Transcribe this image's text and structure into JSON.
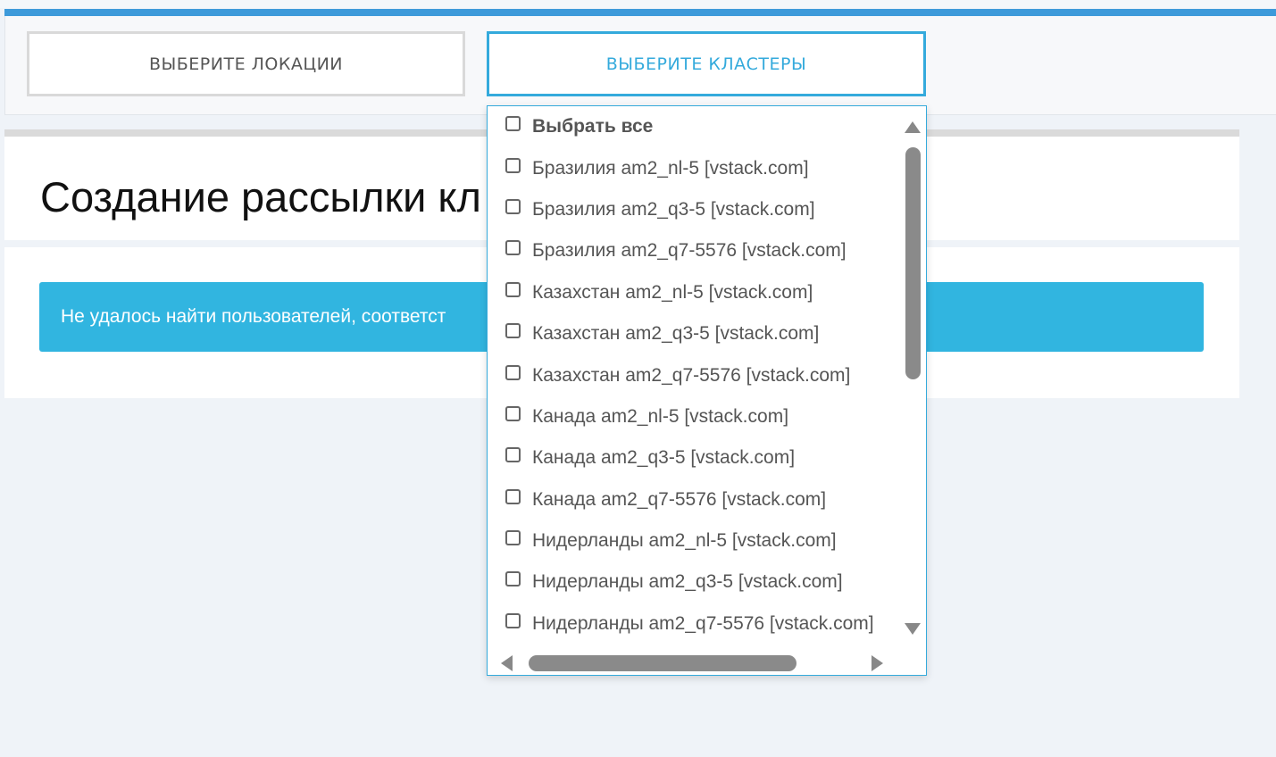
{
  "toolbar": {
    "locations_button": "ВЫБЕРИТЕ ЛОКАЦИИ",
    "clusters_button": "ВЫБЕРИТЕ КЛАСТЕРЫ"
  },
  "page": {
    "title": "Создание рассылки кл",
    "alert": "Не удалось найти пользователей, соответст"
  },
  "dropdown": {
    "select_all": "Выбрать все",
    "items": [
      "Бразилия am2_nl-5 [vstack.com]",
      "Бразилия am2_q3-5 [vstack.com]",
      "Бразилия am2_q7-5576 [vstack.com]",
      "Казахстан am2_nl-5 [vstack.com]",
      "Казахстан am2_q3-5 [vstack.com]",
      "Казахстан am2_q7-5576 [vstack.com]",
      "Канада am2_nl-5 [vstack.com]",
      "Канада am2_q3-5 [vstack.com]",
      "Канада am2_q7-5576 [vstack.com]",
      "Нидерланды am2_nl-5 [vstack.com]",
      "Нидерланды am2_q3-5 [vstack.com]",
      "Нидерланды am2_q7-5576 [vstack.com]"
    ]
  },
  "colors": {
    "accent": "#34aadc",
    "alert_bg": "#31b5e0",
    "top_stripe": "#3d9ada"
  },
  "icons": [
    "scroll-up-arrow-icon",
    "scroll-down-arrow-icon",
    "scroll-left-arrow-icon",
    "scroll-right-arrow-icon",
    "checkbox-icon"
  ]
}
